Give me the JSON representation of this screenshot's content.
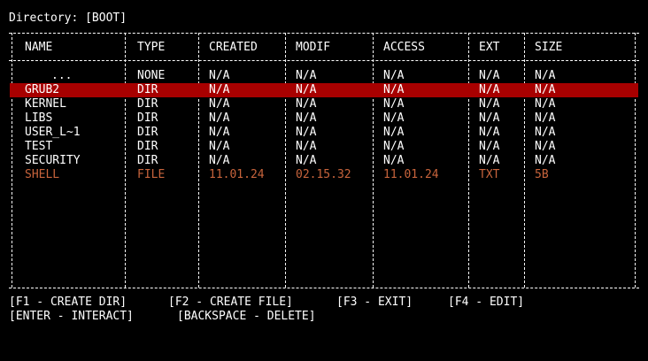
{
  "directory_label": "Directory: [BOOT]",
  "columns": [
    "NAME",
    "TYPE",
    "CREATED",
    "MODIF",
    "ACCESS",
    "EXT",
    "SIZE"
  ],
  "rows": [
    {
      "name": "...",
      "type": "NONE",
      "created": "N/A",
      "modif": "N/A",
      "access": "N/A",
      "ext": "N/A",
      "size": "N/A"
    },
    {
      "name": "GRUB2",
      "type": "DIR",
      "created": "N/A",
      "modif": "N/A",
      "access": "N/A",
      "ext": "N/A",
      "size": "N/A",
      "selected": true
    },
    {
      "name": "KERNEL",
      "type": "DIR",
      "created": "N/A",
      "modif": "N/A",
      "access": "N/A",
      "ext": "N/A",
      "size": "N/A"
    },
    {
      "name": "LIBS",
      "type": "DIR",
      "created": "N/A",
      "modif": "N/A",
      "access": "N/A",
      "ext": "N/A",
      "size": "N/A"
    },
    {
      "name": "USER_L~1",
      "type": "DIR",
      "created": "N/A",
      "modif": "N/A",
      "access": "N/A",
      "ext": "N/A",
      "size": "N/A"
    },
    {
      "name": "TEST",
      "type": "DIR",
      "created": "N/A",
      "modif": "N/A",
      "access": "N/A",
      "ext": "N/A",
      "size": "N/A"
    },
    {
      "name": "SECURITY",
      "type": "DIR",
      "created": "N/A",
      "modif": "N/A",
      "access": "N/A",
      "ext": "N/A",
      "size": "N/A"
    },
    {
      "name": "SHELL",
      "type": "FILE",
      "created": "11.01.24",
      "modif": "02.15.32",
      "access": "11.01.24",
      "ext": "TXT",
      "size": "5B",
      "is_file": true
    }
  ],
  "shortcuts_line1": [
    "[F1 - CREATE DIR]",
    "[F2 - CREATE FILE]",
    "[F3 - EXIT]",
    "[F4 - EDIT]"
  ],
  "shortcuts_line2": [
    "[ENTER - INTERACT]",
    "[BACKSPACE - DELETE]"
  ],
  "colors": {
    "background": "#000000",
    "text": "#ffffff",
    "selection": "#a80000",
    "file_text": "#c8643c"
  }
}
